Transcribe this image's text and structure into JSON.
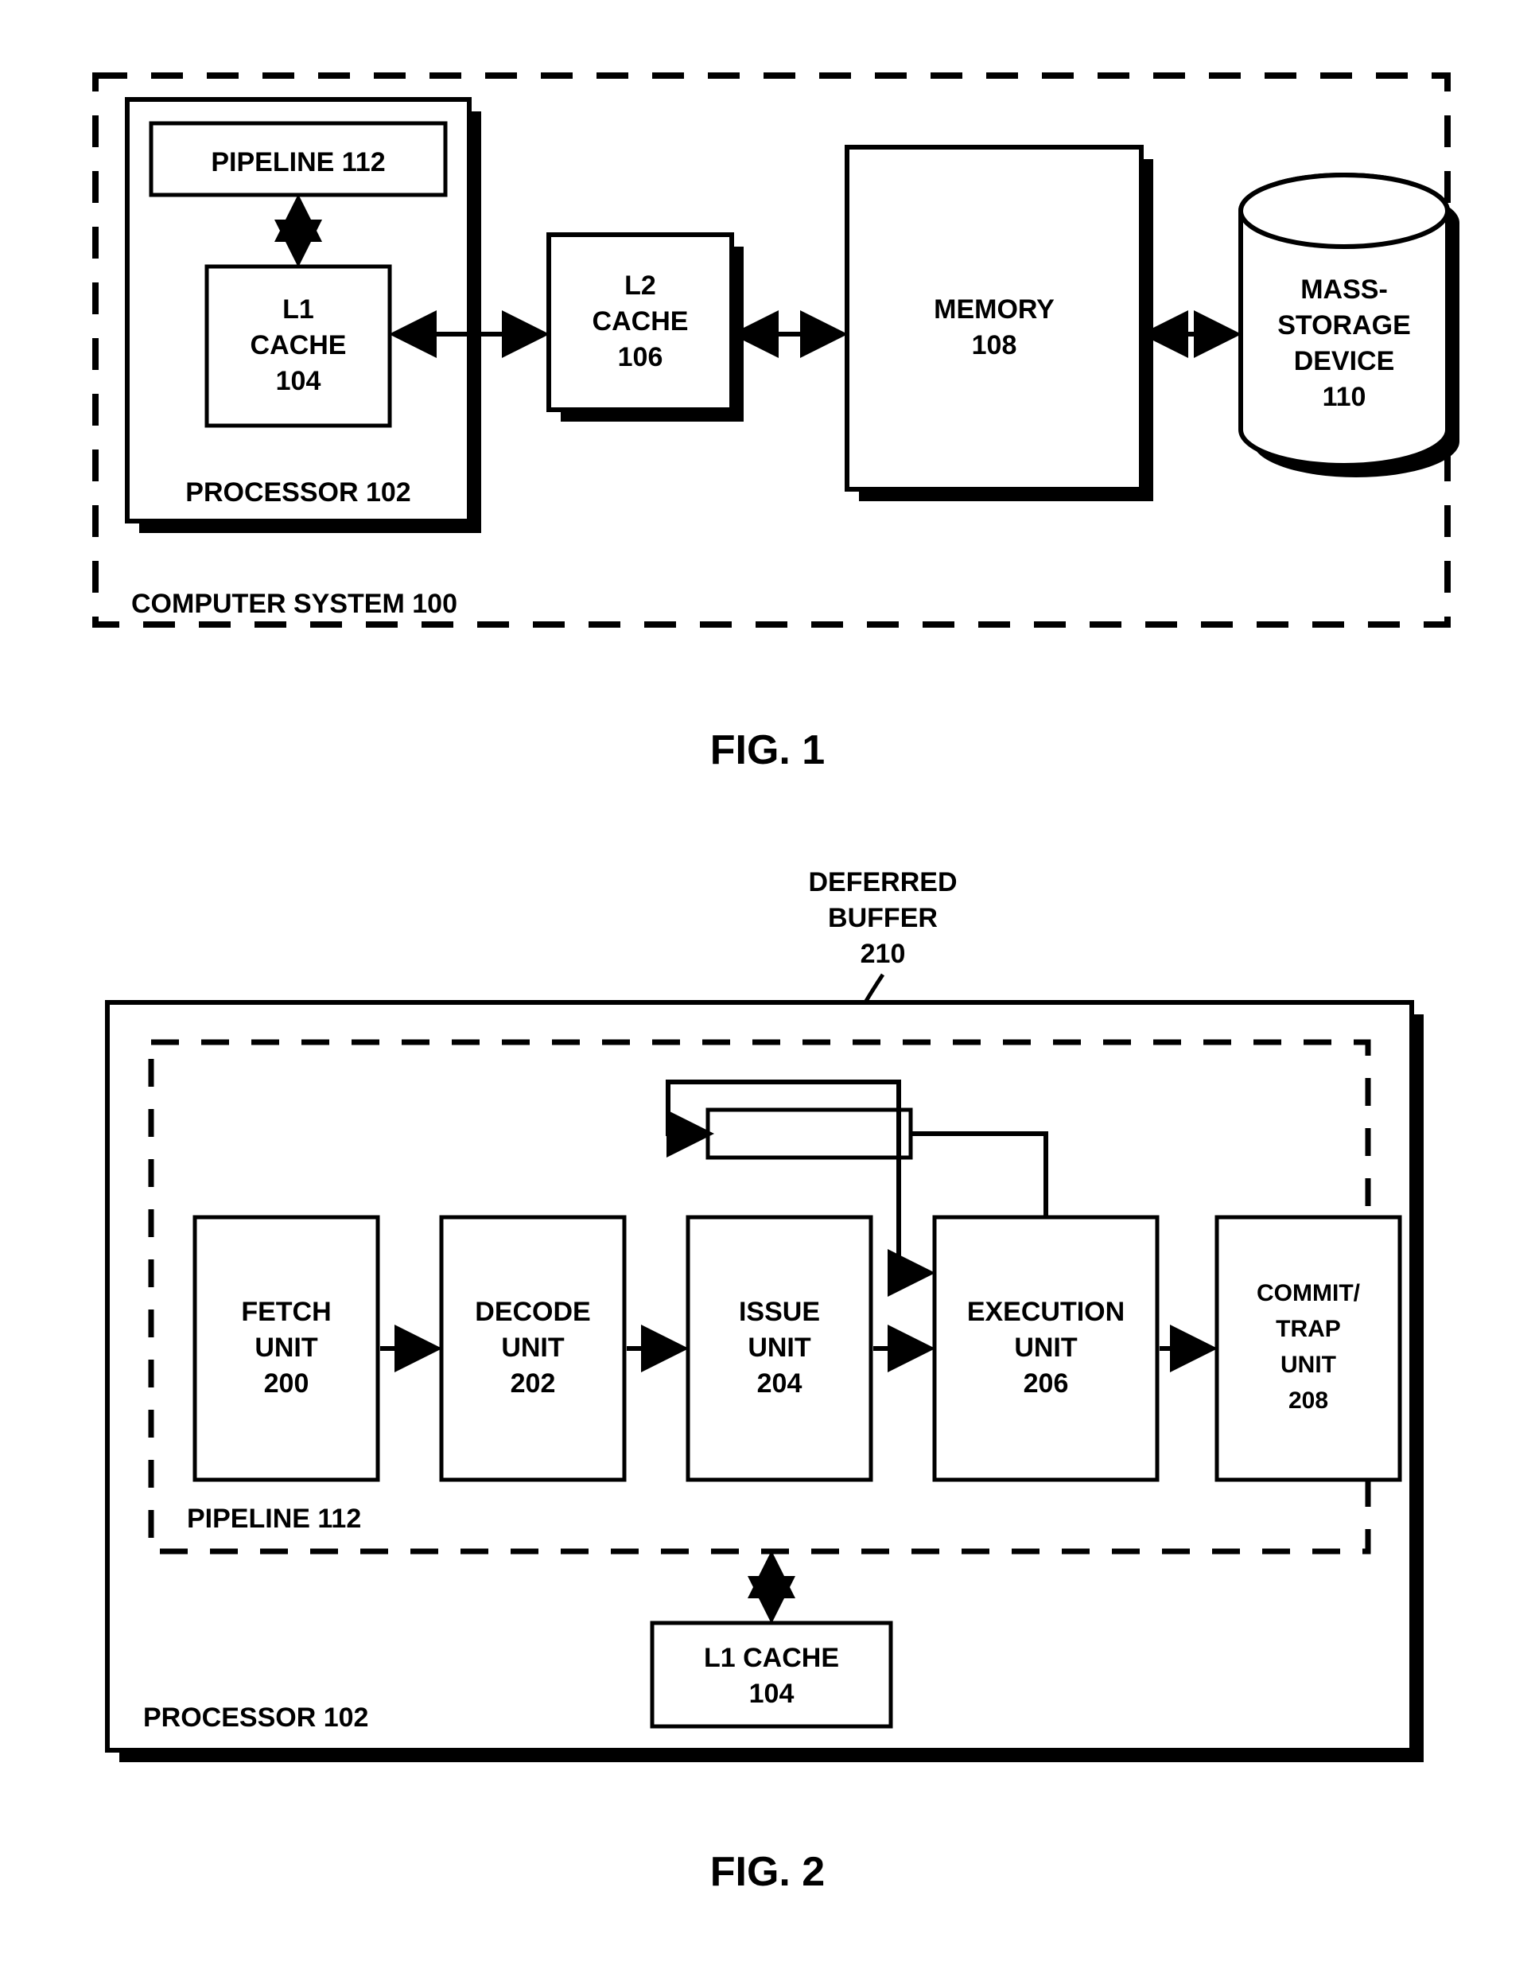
{
  "fig1": {
    "caption": "FIG. 1",
    "outer_label": "COMPUTER SYSTEM 100",
    "processor_label": "PROCESSOR 102",
    "pipeline": "PIPELINE 112",
    "l1_line1": "L1",
    "l1_line2": "CACHE",
    "l1_line3": "104",
    "l2_line1": "L2",
    "l2_line2": "CACHE",
    "l2_line3": "106",
    "mem_line1": "MEMORY",
    "mem_line2": "108",
    "storage_line1": "MASS-",
    "storage_line2": "STORAGE",
    "storage_line3": "DEVICE",
    "storage_line4": "110"
  },
  "fig2": {
    "caption": "FIG. 2",
    "deferred_line1": "DEFERRED",
    "deferred_line2": "BUFFER",
    "deferred_line3": "210",
    "processor_label": "PROCESSOR 102",
    "pipeline_label": "PIPELINE 112",
    "fetch_line1": "FETCH",
    "fetch_line2": "UNIT",
    "fetch_line3": "200",
    "decode_line1": "DECODE",
    "decode_line2": "UNIT",
    "decode_line3": "202",
    "issue_line1": "ISSUE",
    "issue_line2": "UNIT",
    "issue_line3": "204",
    "exec_line1": "EXECUTION",
    "exec_line2": "UNIT",
    "exec_line3": "206",
    "commit_line1": "COMMIT/",
    "commit_line2": "TRAP",
    "commit_line3": "UNIT",
    "commit_line4": "208",
    "l1cache_line1": "L1 CACHE",
    "l1cache_line2": "104"
  }
}
